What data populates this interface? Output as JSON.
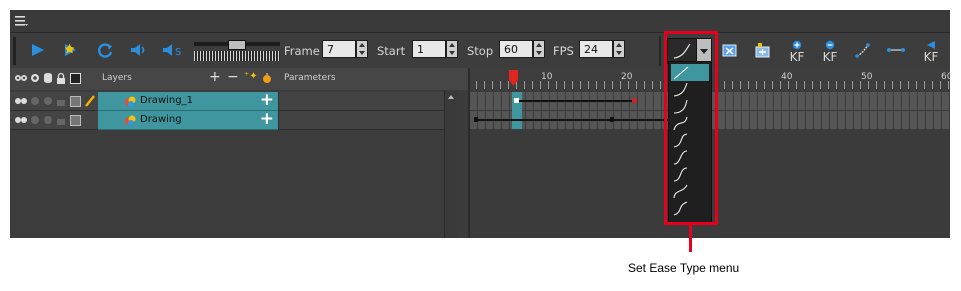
{
  "toolbar": {
    "frame_label": "Frame",
    "frame_value": "7",
    "start_label": "Start",
    "start_value": "1",
    "stop_label": "Stop",
    "stop_value": "60",
    "fps_label": "FPS",
    "fps_value": "24",
    "kf_label": "KF"
  },
  "layers_panel": {
    "layers_label": "Layers",
    "parameters_label": "Parameters",
    "layers": [
      {
        "name": "Drawing_1"
      },
      {
        "name": "Drawing"
      }
    ]
  },
  "timeline": {
    "ticks": [
      "10",
      "20",
      "40",
      "50",
      "60"
    ]
  },
  "callout": {
    "text": "Set Ease Type menu"
  },
  "colors": {
    "accent": "#3f969e",
    "callout": "#e6001e"
  }
}
